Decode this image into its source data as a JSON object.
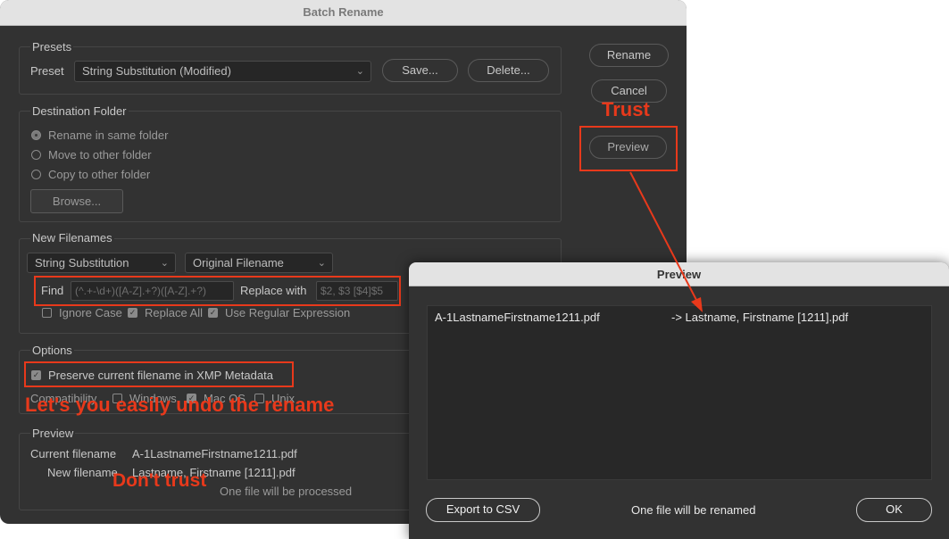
{
  "main_dialog": {
    "title": "Batch Rename",
    "presets": {
      "group_label": "Presets",
      "preset_label": "Preset",
      "preset_value": "String Substitution (Modified)",
      "save_button": "Save...",
      "delete_button": "Delete..."
    },
    "side_buttons": {
      "rename": "Rename",
      "cancel": "Cancel",
      "preview": "Preview"
    },
    "destination": {
      "group_label": "Destination Folder",
      "options": [
        "Rename in same folder",
        "Move to other folder",
        "Copy to other folder"
      ],
      "selected": "Rename in same folder",
      "browse_button": "Browse..."
    },
    "new_filenames": {
      "group_label": "New Filenames",
      "method_value": "String Substitution",
      "source_value": "Original Filename",
      "find_label": "Find",
      "find_value": "(^.+-\\d+)([A-Z].+?)([A-Z].+?)",
      "replace_label": "Replace with",
      "replace_value": "$2, $3 [$4]$5",
      "ignore_case_label": "Ignore Case",
      "ignore_case_checked": false,
      "replace_all_label": "Replace All",
      "replace_all_checked": true,
      "regex_label": "Use Regular Expression",
      "regex_checked": true
    },
    "options": {
      "group_label": "Options",
      "preserve_label": "Preserve current filename in XMP Metadata",
      "preserve_checked": true,
      "compat_label": "Compatibility",
      "windows_label": "Windows",
      "macos_label": "Mac OS",
      "unix_label": "Unix"
    },
    "preview_section": {
      "group_label": "Preview",
      "current_label": "Current filename",
      "current_value": "A-1LastnameFirstname1211.pdf",
      "new_label": "New filename",
      "new_value": "Lastname, Firstname [1211].pdf",
      "processed_text": "One file will be processed"
    }
  },
  "preview_dialog": {
    "title": "Preview",
    "row": {
      "from": "A-1LastnameFirstname1211.pdf",
      "to": "-> Lastname, Firstname [1211].pdf"
    },
    "export_button": "Export to CSV",
    "status_text": "One file will be renamed",
    "ok_button": "OK"
  },
  "annotations": {
    "trust": "Trust",
    "undo_note": "Let's you easily undo the rename",
    "dont_trust": "Don't trust",
    "color": "#e8391b"
  }
}
